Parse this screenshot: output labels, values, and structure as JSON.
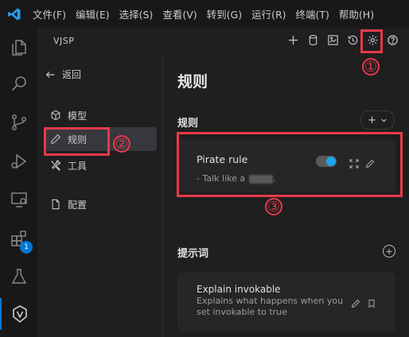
{
  "menubar": {
    "logo": "vscode-logo",
    "items": [
      "文件(F)",
      "编辑(E)",
      "选择(S)",
      "查看(V)",
      "转到(G)",
      "运行(R)",
      "终端(T)",
      "帮助(H)"
    ]
  },
  "activitybar": {
    "items": [
      "explorer-icon",
      "search-icon",
      "source-control-icon",
      "run-debug-icon",
      "remote-explorer-icon",
      "extensions-icon",
      "testing-icon",
      "vjsp-icon"
    ],
    "extensions_badge": "1"
  },
  "sidebar": {
    "title": "VJSP",
    "top_icons": [
      "plus-icon",
      "database-icon",
      "image-icon",
      "history-icon",
      "settings-icon",
      "help-icon"
    ],
    "nav": {
      "back": "返回",
      "items": [
        {
          "label": "模型",
          "icon": "cube-icon"
        },
        {
          "label": "规则",
          "icon": "pencil-icon"
        },
        {
          "label": "工具",
          "icon": "tools-icon"
        },
        {
          "label": "配置",
          "icon": "file-icon"
        }
      ]
    }
  },
  "main": {
    "title": "规则",
    "rules_section": {
      "title": "规则",
      "add_button": "+",
      "rule": {
        "name": "Pirate rule",
        "desc_prefix": "- Talk like a",
        "desc_suffix": ".",
        "enabled": true
      }
    },
    "prompts_section": {
      "title": "提示词",
      "add_button": "+",
      "prompt": {
        "name": "Explain invokable",
        "description": "Explains what happens when you set invokable to true"
      }
    }
  },
  "annotations": {
    "labels": [
      "①",
      "②",
      "③"
    ],
    "color": "#e8394a"
  }
}
